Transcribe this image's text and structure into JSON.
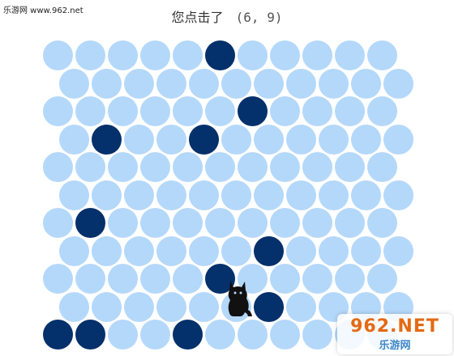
{
  "site_label": "乐游网 www.962.net",
  "status": {
    "text": "您点击了",
    "coords": "(6, 9)"
  },
  "board": {
    "rows": 11,
    "cols": 11,
    "blocked": [
      [
        0,
        5
      ],
      [
        2,
        6
      ],
      [
        3,
        1
      ],
      [
        3,
        4
      ],
      [
        6,
        1
      ],
      [
        7,
        6
      ],
      [
        8,
        5
      ],
      [
        9,
        6
      ],
      [
        10,
        0
      ],
      [
        10,
        1
      ],
      [
        10,
        4
      ]
    ],
    "cat_position": [
      9,
      5
    ],
    "colors": {
      "empty": "#b4d8fa",
      "blocked": "#04306b",
      "cat": "#111111"
    }
  },
  "watermark": {
    "brand": "962.NET",
    "brand2": "乐游网"
  }
}
